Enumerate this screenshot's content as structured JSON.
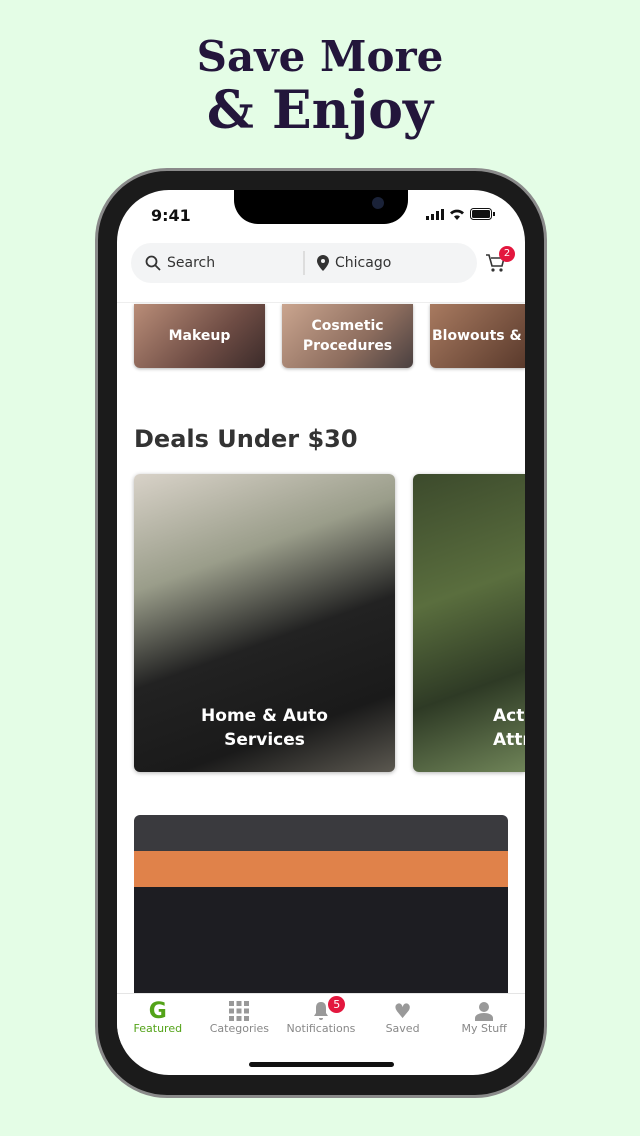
{
  "headline": {
    "line1": "Save More",
    "line2": "& Enjoy"
  },
  "status_bar": {
    "time": "9:41"
  },
  "search": {
    "placeholder": "Search",
    "location": "Chicago"
  },
  "cart": {
    "count": "2"
  },
  "categories": [
    {
      "label": "Makeup"
    },
    {
      "label": "Cosmetic Procedures"
    },
    {
      "label": "Blowouts & Styling"
    }
  ],
  "section": {
    "title": "Deals Under $30"
  },
  "deals": [
    {
      "label": "Home & Auto Services"
    },
    {
      "label": "Activities & Attractions"
    }
  ],
  "tabs": [
    {
      "label": "Featured",
      "icon": "groupon-g-icon"
    },
    {
      "label": "Categories",
      "icon": "grid-icon"
    },
    {
      "label": "Notifications",
      "icon": "bell-icon",
      "badge": "5"
    },
    {
      "label": "Saved",
      "icon": "heart-icon"
    },
    {
      "label": "My Stuff",
      "icon": "user-icon"
    }
  ],
  "colors": {
    "accent": "#53a318",
    "badge": "#e3173e",
    "background": "#e4fde6",
    "headline": "#23163b"
  }
}
